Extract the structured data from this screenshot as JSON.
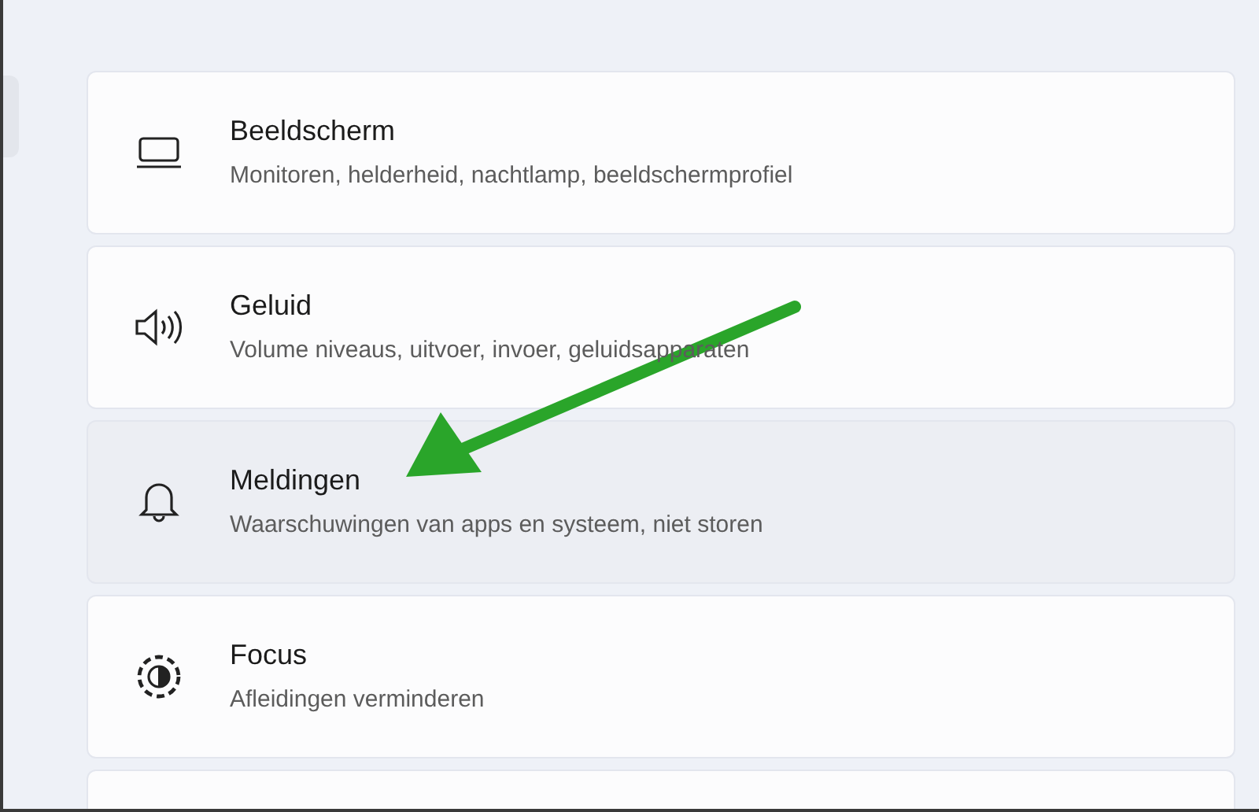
{
  "settings_items": [
    {
      "kind": "display",
      "title": "Beeldscherm",
      "description": "Monitoren, helderheid, nachtlamp, beeldschermprofiel",
      "highlighted": false
    },
    {
      "kind": "sound",
      "title": "Geluid",
      "description": "Volume niveaus, uitvoer, invoer, geluidsapparaten",
      "highlighted": false
    },
    {
      "kind": "notifications",
      "title": "Meldingen",
      "description": "Waarschuwingen van apps en systeem, niet storen",
      "highlighted": true
    },
    {
      "kind": "focus",
      "title": "Focus",
      "description": "Afleidingen verminderen",
      "highlighted": false
    },
    {
      "kind": "empty",
      "highlighted": false
    }
  ]
}
